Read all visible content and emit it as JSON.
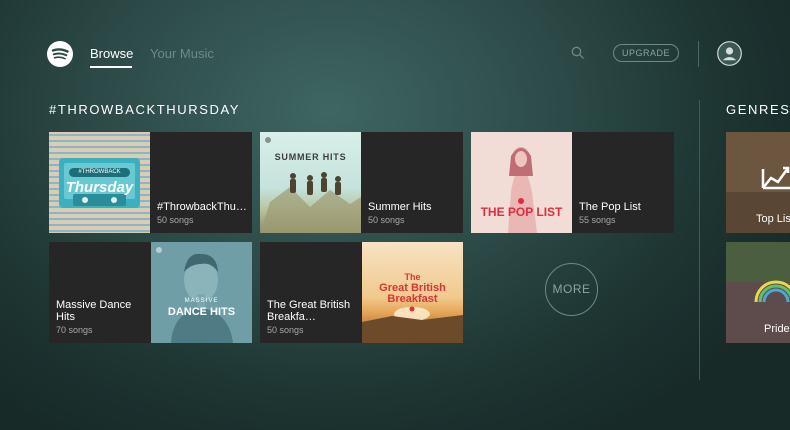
{
  "nav": {
    "tabs": [
      {
        "label": "Browse",
        "active": true
      },
      {
        "label": "Your Music",
        "active": false
      }
    ],
    "upgrade_label": "UPGRADE"
  },
  "sections": {
    "throwback": {
      "title": "#THROWBACKTHURSDAY",
      "tiles": [
        {
          "name": "#ThrowbackThur…",
          "count": "50 songs",
          "art_text": [
            "#THROWBACK",
            "Thursday"
          ]
        },
        {
          "name": "Summer Hits",
          "count": "50 songs",
          "art_text": [
            "SUMMER HITS"
          ]
        },
        {
          "name": "The Pop List",
          "count": "55 songs",
          "art_text": [
            "THE POP LIST"
          ]
        },
        {
          "name": "Massive Dance Hits",
          "count": "70 songs",
          "art_text": [
            "MASSIVE",
            "DANCE HITS"
          ]
        },
        {
          "name": "The Great British Breakfa…",
          "count": "50 songs",
          "art_text": [
            "The",
            "Great British",
            "Breakfast"
          ]
        }
      ],
      "more_label": "MORE"
    },
    "genres": {
      "title": "GENRES &",
      "tiles": [
        {
          "label": "Top Lis"
        },
        {
          "label": "Pride"
        }
      ]
    }
  },
  "colors": {
    "background": "#2c4a47",
    "tile": "#262626",
    "accent_red": "#e02d3c"
  }
}
